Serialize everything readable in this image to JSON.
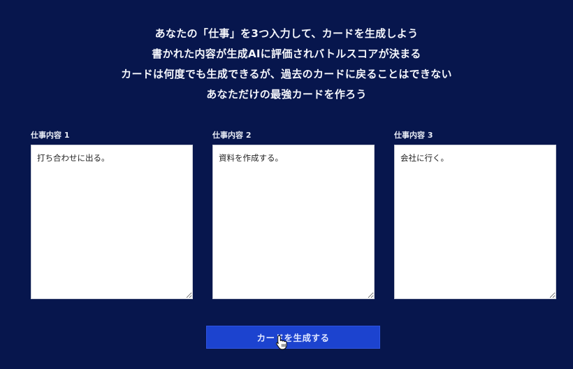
{
  "intro": {
    "lines": [
      "あなたの「仕事」を3つ入力して、カードを生成しよう",
      "書かれた内容が生成AIに評価されバトルスコアが決まる",
      "カードは何度でも生成できるが、過去のカードに戻ることはできない",
      "あなただけの最強カードを作ろう"
    ]
  },
  "jobs": [
    {
      "label": "仕事内容 1",
      "value": "打ち合わせに出る。"
    },
    {
      "label": "仕事内容 2",
      "value": "資料を作成する。"
    },
    {
      "label": "仕事内容 3",
      "value": "会社に行く。"
    }
  ],
  "generate_button": {
    "label": "カードを生成する"
  },
  "icons": {
    "cursor": "hand-pointer-icon"
  },
  "colors": {
    "background": "#07164d",
    "button": "#1c43cf"
  }
}
